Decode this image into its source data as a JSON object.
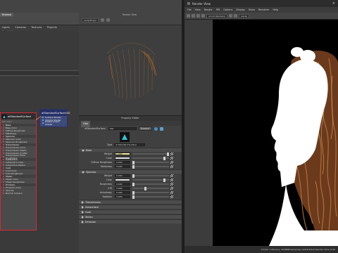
{
  "left_panel": {
    "tabs": [
      "Browse"
    ],
    "sub_tabs": [
      "Lights",
      "Cameras",
      "Textures",
      "Projects",
      "Asset Library"
    ],
    "breadcrumb": ""
  },
  "viewport": {
    "title": "Render View",
    "camera": "perspShape"
  },
  "shader_node": {
    "name": "aiStandardSurface",
    "sub": "Out Color",
    "ports": [
      {
        "label": "Base",
        "section": true
      },
      {
        "label": "Base Color"
      },
      {
        "label": "Diffuse Roughness"
      },
      {
        "label": "Metalness"
      },
      {
        "label": "Specular",
        "section": true
      },
      {
        "label": "Specular Color"
      },
      {
        "label": "Specular Roughness"
      },
      {
        "label": "Transmission",
        "section": true
      },
      {
        "label": "Transmission Color"
      },
      {
        "label": "Transmission Depth"
      },
      {
        "label": "Transmission Scatter"
      },
      {
        "label": "Transmission Extra Roughness"
      },
      {
        "label": "Subsurface",
        "section": true
      },
      {
        "label": "Subsurface Color"
      },
      {
        "label": "Subsurface Radius"
      },
      {
        "label": "Coat",
        "section": true
      },
      {
        "label": "Coat Color"
      },
      {
        "label": "Coat Roughness"
      },
      {
        "label": "Sheen",
        "section": true
      },
      {
        "label": "Sheen Color"
      },
      {
        "label": "Sheen Roughness"
      },
      {
        "label": "Emission",
        "section": true
      },
      {
        "label": "Emission Color"
      },
      {
        "label": "Opacity"
      },
      {
        "label": "Normal Camera"
      }
    ]
  },
  "sg_node": {
    "name": "aiStandardSurface1SG",
    "ports": [
      "Surface Shader",
      "Volume Shader",
      "Displacement Shader"
    ]
  },
  "attribute_editor": {
    "title": "Property Editor",
    "tab": "Hair",
    "node_label": "aiStandardSurface:",
    "node_value": "Hair",
    "presets_button": "Presets*",
    "type_label": "Type",
    "type_value": "ai Standard Surface",
    "sections": [
      {
        "name": "Base",
        "open": true,
        "rows": [
          {
            "label": "Weight",
            "value": "1.000",
            "level": 1.0,
            "highlight": true
          },
          {
            "label": "Color",
            "value": "",
            "level": 0.9
          },
          {
            "label": "Diffuse Roughness",
            "value": "0.000",
            "level": 0.0
          },
          {
            "label": "Metalness",
            "value": "0.000",
            "level": 0.0
          }
        ]
      },
      {
        "name": "Specular",
        "open": true,
        "rows": [
          {
            "label": "Weight",
            "value": "0.000",
            "level": 0.0
          },
          {
            "label": "Color",
            "value": "",
            "level": 0.9
          },
          {
            "label": "Roughness",
            "value": "0.000",
            "level": 0.0
          },
          {
            "label": "IOR",
            "value": "0.000",
            "level": 0.35
          },
          {
            "label": "Anisotropy",
            "value": "0.000",
            "level": 0.0
          },
          {
            "label": "Rotation",
            "value": "0.000",
            "level": 0.0
          }
        ]
      },
      {
        "name": "Transmission",
        "open": false,
        "rows": []
      },
      {
        "name": "Subsurface",
        "open": false,
        "rows": []
      },
      {
        "name": "Coat",
        "open": false,
        "rows": []
      },
      {
        "name": "Sheen",
        "open": false,
        "rows": []
      },
      {
        "name": "Emission",
        "open": false,
        "rows": []
      }
    ]
  },
  "render_view": {
    "title": "Render View",
    "menu": [
      "File",
      "View",
      "Render",
      "IPR",
      "Options",
      "Display",
      "Show",
      "Renderer",
      "Help"
    ],
    "renderer": "Arnold Renderer",
    "camera": "persp",
    "status": "Frame: 1    Memory: 2048MB    Sampling: [2/2/2/2/2/2]    Render Time: 0:42"
  }
}
